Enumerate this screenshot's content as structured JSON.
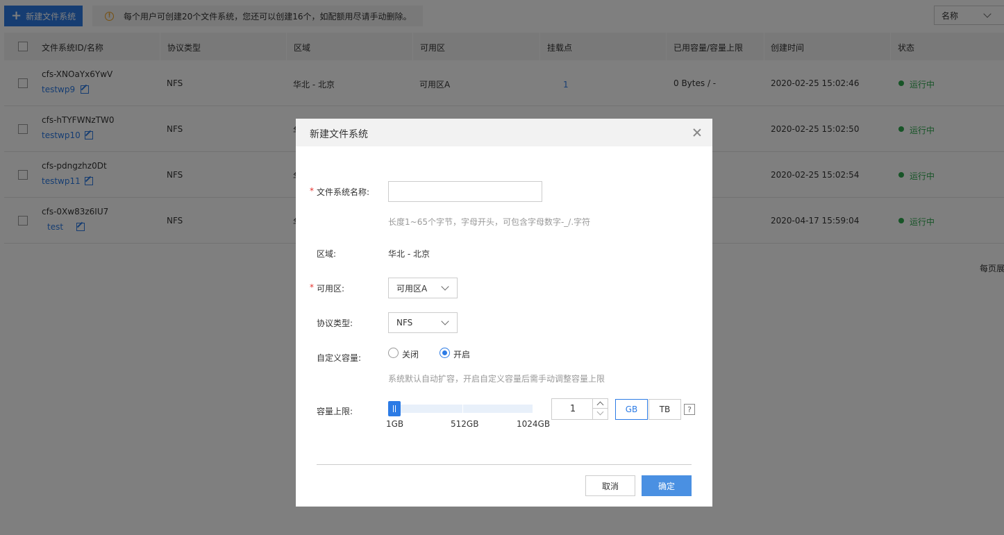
{
  "toolbar": {
    "new_button_label": "新建文件系统",
    "notice": "每个用户可创建20个文件系统，您还可以创建16个，如配额用尽请手动删除。",
    "sort_value": "名称"
  },
  "table": {
    "headers": [
      "文件系统ID/名称",
      "协议类型",
      "区域",
      "可用区",
      "挂载点",
      "已用容量/容量上限",
      "创建时间",
      "状态"
    ],
    "rows": [
      {
        "id": "cfs-XNOaYx6YwV",
        "name": "testwp9",
        "protocol": "NFS",
        "region": "华北 - 北京",
        "zone": "可用区A",
        "mounts": "1",
        "capacity": "0 Bytes / -",
        "created": "2020-02-25 15:02:46",
        "status": "运行中"
      },
      {
        "id": "cfs-hTYFWNzTW0",
        "name": "testwp10",
        "protocol": "NFS",
        "region": "华",
        "zone": "",
        "mounts": "",
        "capacity": "-",
        "created": "2020-02-25 15:02:50",
        "status": "运行中"
      },
      {
        "id": "cfs-pdngzhz0Dt",
        "name": "testwp11",
        "protocol": "NFS",
        "region": "华",
        "zone": "",
        "mounts": "",
        "capacity": "-",
        "created": "2020-02-25 15:02:54",
        "status": "运行中"
      },
      {
        "id": "cfs-0Xw83z6IU7",
        "name": "test",
        "protocol": "NFS",
        "region": "华",
        "zone": "",
        "mounts": "",
        "capacity": "-",
        "created": "2020-04-17 15:59:04",
        "status": "运行中"
      }
    ],
    "pager_text": "每页展"
  },
  "modal": {
    "title": "新建文件系统",
    "name_label": "文件系统名称:",
    "name_value": "",
    "name_hint": "长度1~65个字节，字母开头，可包含字母数字-_/.字符",
    "region_label": "区域:",
    "region_value": "华北 - 北京",
    "zone_label": "可用区:",
    "zone_value": "可用区A",
    "protocol_label": "协议类型:",
    "protocol_value": "NFS",
    "custom_capacity_label": "自定义容量:",
    "radio_off": "关闭",
    "radio_on": "开启",
    "radio_selected": "开启",
    "capacity_hint": "系统默认自动扩容，开启自定义容量后需手动调整容量上限",
    "capacity_limit_label": "容量上限:",
    "slider_ticks": [
      "1GB",
      "512GB",
      "1024GB"
    ],
    "slider_value_fraction": 0,
    "stepper_value": "1",
    "unit_gb": "GB",
    "unit_tb": "TB",
    "unit_selected": "GB",
    "help_glyph": "?",
    "cancel_label": "取消",
    "ok_label": "确定"
  },
  "colors": {
    "accent": "#2c7be5",
    "ok_button": "#4a90e2",
    "status_running": "#2fa84f",
    "required": "#e5322d",
    "warning": "#f0a020"
  },
  "icons": {
    "new_button": "plus-icon",
    "notice": "warning-icon",
    "row_edit": "edit-icon",
    "modal_close": "close-icon",
    "select_arrow": "chevron-down-icon",
    "help": "help-icon"
  }
}
